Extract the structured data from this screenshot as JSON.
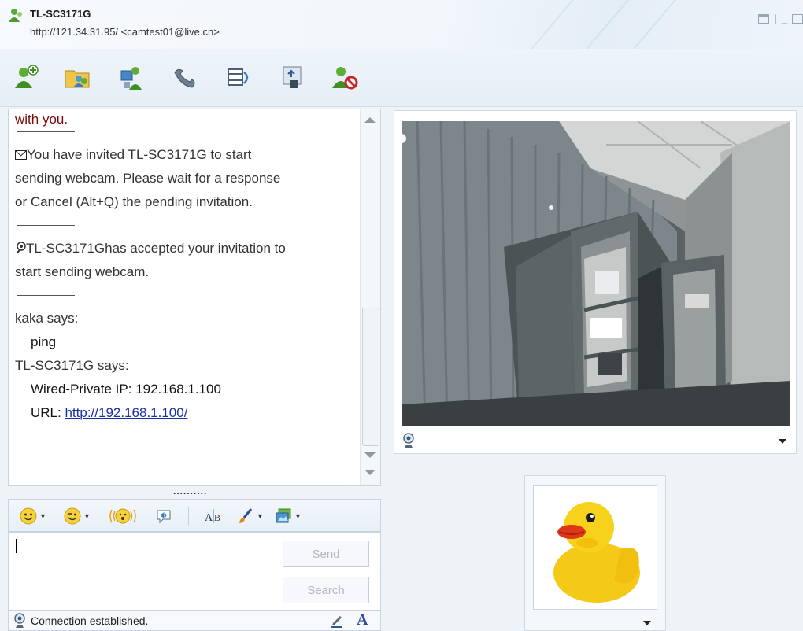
{
  "window": {
    "contact_name": "TL-SC3171G",
    "contact_address": "http://121.34.31.95/ <camtest01@live.cn>"
  },
  "toolbar": {
    "icons": [
      "invite-contact-icon",
      "share-folders-icon",
      "call-computer-icon",
      "call-phone-icon",
      "video-call-icon",
      "games-icon",
      "block-contact-icon"
    ]
  },
  "history": {
    "top_fragment": "with you.",
    "invite_lines": [
      "You have invited TL-SC3171G to start",
      "sending webcam. Please wait for a response",
      "or Cancel (Alt+Q) the pending invitation."
    ],
    "accept_lines": [
      "TL-SC3171Ghas accepted your invitation to",
      "start sending webcam."
    ],
    "msg1_sender": "kaka says:",
    "msg1_text": "ping",
    "msg2_sender": "TL-SC3171G says:",
    "msg2_line1": "Wired-Private IP: 192.168.1.100",
    "msg2_url_label": "URL: ",
    "msg2_url": "http://192.168.1.100/"
  },
  "splitter": "..........",
  "compose": {
    "send_label": "Send",
    "search_label": "Search",
    "text": ""
  },
  "status": {
    "text": "Connection established."
  },
  "colors": {
    "accent": "#1a2fa8",
    "maroon": "#7a0c0c",
    "panel_border": "#c8d4e0"
  }
}
